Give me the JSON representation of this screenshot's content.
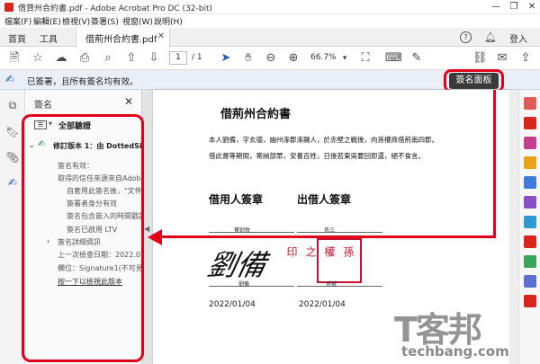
{
  "window": {
    "title": "借貸州合約書.pdf - Adobe Acrobat Pro DC (32-bit)",
    "controls": [
      "—",
      "❐",
      "✕"
    ]
  },
  "menu": [
    "檔案(F)",
    "編輯(E)",
    "檢視(V)",
    "簽署(S)",
    "視窗(W)",
    "說明(H)"
  ],
  "tabs": {
    "home": "首頁",
    "tools": "工具",
    "document": "借荊州合約書.pdf",
    "help_icon": "?",
    "login": "登入"
  },
  "toolbar": {
    "page_current": "1",
    "page_total": "/ 1",
    "zoom": "66.7%"
  },
  "signature_bar": {
    "status": "已簽署，且所有簽名均有效。",
    "panel_button": "簽名面板"
  },
  "signature_panel": {
    "header": "簽名",
    "close": "✕",
    "validate_all": "全部驗證",
    "revision": "修訂版本 1：由 DottedSign",
    "items": [
      "簽名有效：",
      "取得的信任來源來自Adobe",
      "自套用此簽名後，\"文件\"",
      "簽署者身分有效",
      "簽名包含嵌入的時間戳記",
      "簽名已啟用 LTV"
    ],
    "details": "簽名詳細資訊",
    "last_checked": "上一次檢查日期：2022.01.0",
    "field": "欄位：Signature1(不可見簽",
    "link": "按一下以檢視此版本"
  },
  "document": {
    "title": "借荊州合約書",
    "para1": "本人劉備，字玄德，幽州涿郡涿縣人，於赤壁之戰後，向孫權商借荊南四郡。",
    "para2": "借此督等期間，寄納部眾，安養百姓，日後若東吳要回即還，絕不食言。",
    "borrower_heading": "借用人簽章",
    "lender_heading": "出借人簽章",
    "borrower_small": "寶劍牧",
    "lender_small": "孫三",
    "borrower_name": "劉備",
    "lender_name": "孫權",
    "borrower_date": "2022/01/04",
    "lender_date": "2022/01/04",
    "signature_script": "劉備",
    "seal_text": "孫權之印"
  },
  "watermark": {
    "main": "T客邦",
    "sub": "techbang.com"
  },
  "colors": {
    "accent_red": "#e2001a",
    "banner_bg": "#e9eef7",
    "panel_btn": "#3a3a3a",
    "acrobat_red": "#d9261c"
  }
}
